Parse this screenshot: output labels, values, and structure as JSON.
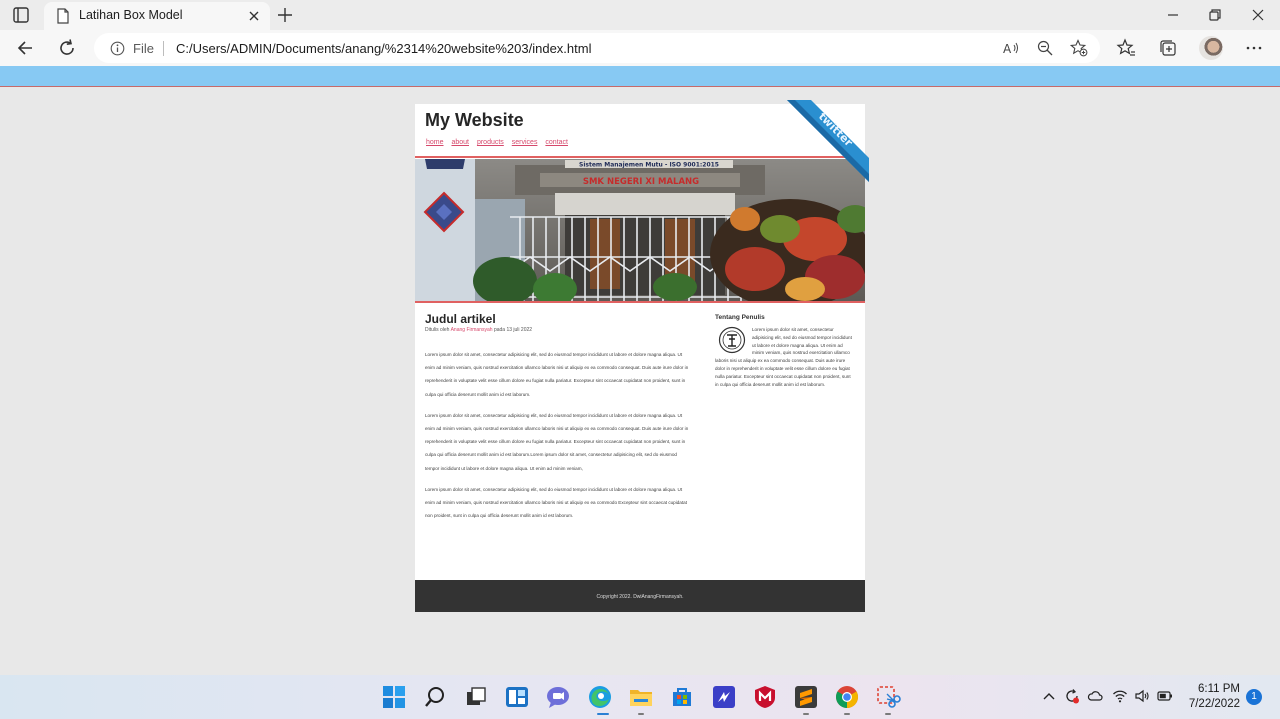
{
  "browser": {
    "tab_title": "Latihan Box Model",
    "file_label": "File",
    "url": "C:/Users/ADMIN/Documents/anang/%2314%20website%203/index.html"
  },
  "site": {
    "title": "My Website",
    "menu": [
      "home",
      "about",
      "products",
      "services",
      "contact"
    ],
    "ribbon_text": "twitter",
    "banner": {
      "sign_top": "Sistem Manajemen Mutu - ISO 9001:2015",
      "sign_name": "SMK NEGERI XI MALANG"
    }
  },
  "article": {
    "title": "Judul artikel",
    "meta_prefix": "Ditulis oleh",
    "meta_author": "Anang Firmansyah",
    "meta_suffix": "pada 13 juli 2022",
    "paragraphs": [
      "Lorem ipsum dolor sit amet, consectetur adipisicing elit, sed do eiusmod tempor incididunt ut labore et dolore magna aliqua. Ut enim ad minim veniam, quis nostrud exercitation ullamco laboris nisi ut aliquip ex ea commodo consequat. Duis aute irure dolor in reprehenderit in voluptate velit esse cillum dolore eu fugiat nulla pariatur. Excepteur sint occaecat cupidatat non proident, sunt in culpa qui officia deserunt mollit anim id est laborum.",
      "Lorem ipsum dolor sit amet, consectetur adipisicing elit, sed do eiusmod tempor incididunt ut labore et dolore magna aliqua. Ut enim ad minim veniam, quis nostrud exercitation ullamco laboris nisi ut aliquip ex ea commodo consequat. Duis aute irure dolor in reprehenderit in voluptate velit esse cillum dolore eu fugiat nulla pariatur. Excepteur sint occaecat cupidatat non proident, sunt in culpa qui officia deserunt mollit anim id est laborum.Lorem ipsum dolor sit amet, consectetur adipisicing elit, sed do eiusmod tempor incididunt ut labore et dolore magna aliqua. Ut enim ad minim veniam,",
      "Lorem ipsum dolor sit amet, consectetur adipisicing elit, sed do eiusmod tempor incididunt ut labore et dolore magna aliqua. Ut enim ad minim veniam, quis nostrud exercitation ullamco laboris nisi ut aliquip ex ea commodo Excepteur sint occaecat cupidatat non proident, sunt in culpa qui officia deserunt mollit anim id est laborum."
    ]
  },
  "sidebar": {
    "title": "Tentang Penulis",
    "body": "Lorem ipsum dolor sit amet, consectetur adipisicing elit, sed do eiusmod tempor incididunt ut labore et dolore magna aliqua. Ut enim ad minim veniam, quis nostrud exercitation ullamco laboris nisi ut aliquip ex ea commodo consequat. Duis aute irure dolor in reprehenderit in voluptate velit esse cillum dolore eu fugiat nulla pariatur. Excepteur sint occaecat cupidatat non proident, sunt in culpa qui officia deserunt mollit anim id est laborum."
  },
  "footer": {
    "copyright": "Copyright 2022. DwiAnangFirmansyah."
  },
  "taskbar": {
    "time": "6:11 PM",
    "date": "7/22/2022",
    "notifications": "1"
  },
  "colors": {
    "top_bar": "#87c9f3",
    "accent_red": "#e06161",
    "link": "#d6486b",
    "footer_bg": "#333333",
    "ribbon": "#2a8fd0"
  }
}
